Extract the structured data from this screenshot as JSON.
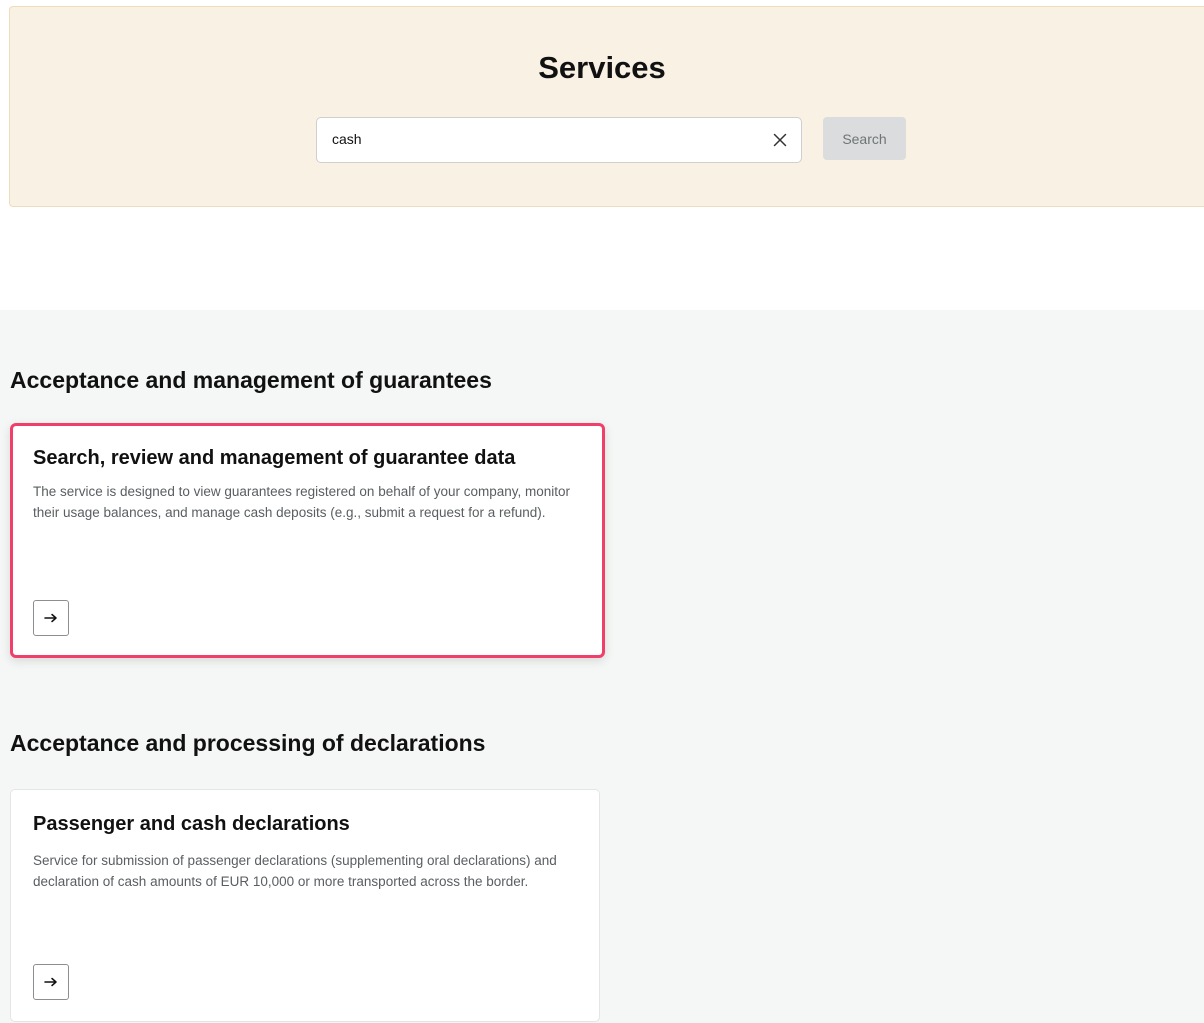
{
  "header": {
    "title": "Services"
  },
  "search": {
    "value": "cash",
    "clear_icon": "close-icon",
    "button_label": "Search"
  },
  "sections": [
    {
      "title": "Acceptance and management of guarantees",
      "cards": [
        {
          "title": "Search, review and management of guarantee data",
          "description": "The service is designed to view guarantees registered on behalf of your company, monitor their usage balances, and manage cash deposits (e.g., submit a request for a refund).",
          "highlighted": true,
          "arrow_icon": "arrow-right-icon"
        }
      ]
    },
    {
      "title": "Acceptance and processing of declarations",
      "cards": [
        {
          "title": "Passenger and cash declarations",
          "description": "Service for submission of passenger declarations (supplementing oral declarations) and declaration of cash amounts of EUR 10,000 or more transported across the border.",
          "highlighted": false,
          "arrow_icon": "arrow-right-icon"
        }
      ]
    }
  ],
  "colors": {
    "hero_background": "#f9f1e3",
    "highlight_border": "#ef3f6a",
    "page_background": "#f5f7f6"
  }
}
